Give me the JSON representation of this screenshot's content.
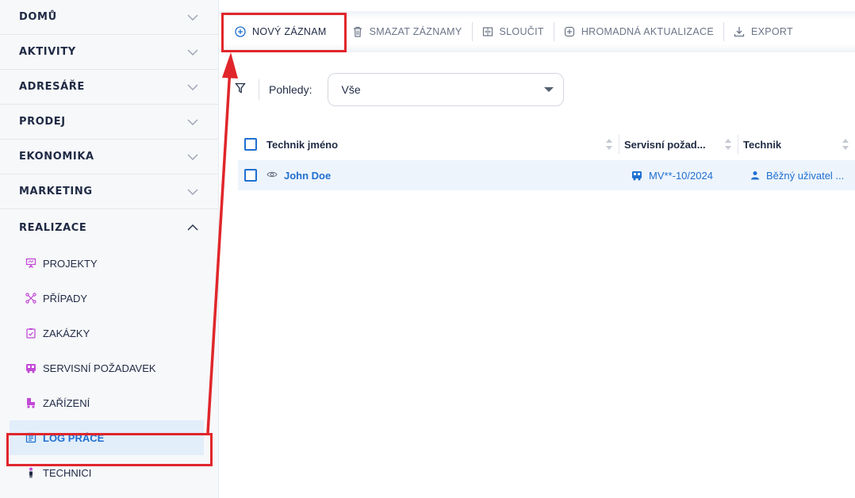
{
  "sidebar": {
    "sections": [
      {
        "label": "DOMŮ",
        "expanded": false
      },
      {
        "label": "AKTIVITY",
        "expanded": false
      },
      {
        "label": "ADRESÁŘE",
        "expanded": false
      },
      {
        "label": "PRODEJ",
        "expanded": false
      },
      {
        "label": "EKONOMIKA",
        "expanded": false
      },
      {
        "label": "MARKETING",
        "expanded": false
      },
      {
        "label": "REALIZACE",
        "expanded": true
      }
    ],
    "subitems": [
      {
        "label": "PROJEKTY",
        "icon": "presentation-icon"
      },
      {
        "label": "PŘÍPADY",
        "icon": "network-icon"
      },
      {
        "label": "ZAKÁZKY",
        "icon": "clipboard-check-icon"
      },
      {
        "label": "SERVISNÍ POŽADAVEK",
        "icon": "service-truck-icon"
      },
      {
        "label": "ZAŘÍZENÍ",
        "icon": "device-truck-icon"
      },
      {
        "label": "LOG PRÁCE",
        "icon": "log-list-icon",
        "active": true
      },
      {
        "label": "TECHNICI",
        "icon": "technician-icon"
      }
    ]
  },
  "toolbar": {
    "new_record": "NOVÝ ZÁZNAM",
    "delete_records": "SMAZAT ZÁZNAMY",
    "merge": "SLOUČIT",
    "bulk_update": "HROMADNÁ AKTUALIZACE",
    "export": "EXPORT"
  },
  "filter": {
    "label": "Pohledy:",
    "selected": "Vše"
  },
  "table": {
    "headers": [
      "Technik jméno",
      "Servisní požad...",
      "Technik"
    ],
    "rows": [
      {
        "name": "John Doe",
        "service_request": "MV**-10/2024",
        "technician": "Běžný uživatel ..."
      }
    ]
  },
  "colors": {
    "accent": "#1f6fd0",
    "highlight_box": "#e0262b",
    "active_bg": "#e2eefa",
    "icon_purple": "#c24ad6"
  }
}
